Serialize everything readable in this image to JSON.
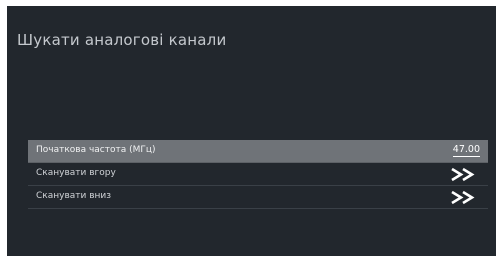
{
  "screen": {
    "title": "Шукати аналогові канали"
  },
  "menu": {
    "items": [
      {
        "label": "Початкова частота (МГц)",
        "value": "47.00",
        "selected": true
      },
      {
        "label": "Сканувати вгору",
        "icon": "double-chevron-right-icon"
      },
      {
        "label": "Сканувати вниз",
        "icon": "double-chevron-right-icon"
      }
    ]
  },
  "colors": {
    "background": "#22272d",
    "selected_row": "#6f7378",
    "text": "#d0d3d7"
  }
}
